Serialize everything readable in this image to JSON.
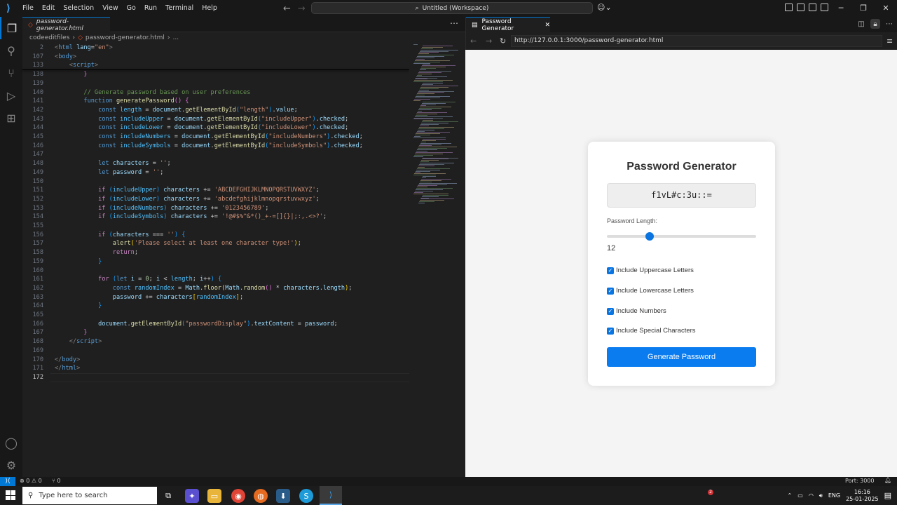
{
  "titlebar": {
    "menu": [
      "File",
      "Edit",
      "Selection",
      "View",
      "Go",
      "Run",
      "Terminal",
      "Help"
    ],
    "command_center": "Untitled (Workspace)"
  },
  "editor": {
    "tab_label": "password-generator.html",
    "breadcrumb": [
      "codeeditfiles",
      "password-generator.html",
      "..."
    ],
    "lines": [
      {
        "n": "2",
        "html": "<span class='p'>&lt;</span><span class='t'>html</span> <span class='v'>lang</span>=<span class='s'>\"en\"</span><span class='p'>&gt;</span>"
      },
      {
        "n": "107",
        "html": "<span class='p'>&lt;</span><span class='t'>body</span><span class='p'>&gt;</span>"
      },
      {
        "n": "133",
        "html": "    <span class='p'>&lt;</span><span class='t'>script</span><span class='p'>&gt;</span>"
      },
      {
        "n": "138",
        "html": "        <span class='br2'>}</span>"
      },
      {
        "n": "139",
        "html": ""
      },
      {
        "n": "140",
        "html": "        <span class='c'>// Generate password based on user preferences</span>"
      },
      {
        "n": "141",
        "html": "        <span class='k'>function</span> <span class='f'>generatePassword</span><span class='br2'>()</span> <span class='br2'>{</span>"
      },
      {
        "n": "142",
        "html": "            <span class='k'>const</span> <span class='o'>length</span> = <span class='v'>document</span>.<span class='f'>getElementById</span><span class='br3'>(</span><span class='s'>\"length\"</span><span class='br3'>)</span>.<span class='v'>value</span>;"
      },
      {
        "n": "143",
        "html": "            <span class='k'>const</span> <span class='o'>includeUpper</span> = <span class='v'>document</span>.<span class='f'>getElementById</span><span class='br3'>(</span><span class='s'>\"includeUpper\"</span><span class='br3'>)</span>.<span class='v'>checked</span>;"
      },
      {
        "n": "144",
        "html": "            <span class='k'>const</span> <span class='o'>includeLower</span> = <span class='v'>document</span>.<span class='f'>getElementById</span><span class='br3'>(</span><span class='s'>\"includeLower\"</span><span class='br3'>)</span>.<span class='v'>checked</span>;"
      },
      {
        "n": "145",
        "html": "            <span class='k'>const</span> <span class='o'>includeNumbers</span> = <span class='v'>document</span>.<span class='f'>getElementById</span><span class='br3'>(</span><span class='s'>\"includeNumbers\"</span><span class='br3'>)</span>.<span class='v'>checked</span>;"
      },
      {
        "n": "146",
        "html": "            <span class='k'>const</span> <span class='o'>includeSymbols</span> = <span class='v'>document</span>.<span class='f'>getElementById</span><span class='br3'>(</span><span class='s'>\"includeSymbols\"</span><span class='br3'>)</span>.<span class='v'>checked</span>;"
      },
      {
        "n": "147",
        "html": ""
      },
      {
        "n": "148",
        "html": "            <span class='k'>let</span> <span class='v'>characters</span> = <span class='s'>''</span>;"
      },
      {
        "n": "149",
        "html": "            <span class='k'>let</span> <span class='v'>password</span> = <span class='s'>''</span>;"
      },
      {
        "n": "150",
        "html": ""
      },
      {
        "n": "151",
        "html": "            <span class='kc'>if</span> <span class='br3'>(</span><span class='o'>includeUpper</span><span class='br3'>)</span> <span class='v'>characters</span> += <span class='s'>'ABCDEFGHIJKLMNOPQRSTUVWXYZ'</span>;"
      },
      {
        "n": "152",
        "html": "            <span class='kc'>if</span> <span class='br3'>(</span><span class='o'>includeLower</span><span class='br3'>)</span> <span class='v'>characters</span> += <span class='s'>'abcdefghijklmnopqrstuvwxyz'</span>;"
      },
      {
        "n": "153",
        "html": "            <span class='kc'>if</span> <span class='br3'>(</span><span class='o'>includeNumbers</span><span class='br3'>)</span> <span class='v'>characters</span> += <span class='s'>'0123456789'</span>;"
      },
      {
        "n": "154",
        "html": "            <span class='kc'>if</span> <span class='br3'>(</span><span class='o'>includeSymbols</span><span class='br3'>)</span> <span class='v'>characters</span> += <span class='s'>'!@#$%^&amp;*()_+-=[]{}|;:,.&lt;&gt;?'</span>;"
      },
      {
        "n": "155",
        "html": ""
      },
      {
        "n": "156",
        "html": "            <span class='kc'>if</span> <span class='br3'>(</span><span class='v'>characters</span> === <span class='s'>''</span><span class='br3'>)</span> <span class='br3'>{</span>"
      },
      {
        "n": "157",
        "html": "                <span class='f'>alert</span><span class='br'>(</span><span class='s'>'Please select at least one character type!'</span><span class='br'>)</span>;"
      },
      {
        "n": "158",
        "html": "                <span class='kc'>return</span>;"
      },
      {
        "n": "159",
        "html": "            <span class='br3'>}</span>"
      },
      {
        "n": "160",
        "html": ""
      },
      {
        "n": "161",
        "html": "            <span class='kc'>for</span> <span class='br3'>(</span><span class='k'>let</span> <span class='v'>i</span> = <span class='n'>0</span>; <span class='v'>i</span> &lt; <span class='o'>length</span>; <span class='v'>i</span>++<span class='br3'>)</span> <span class='br3'>{</span>"
      },
      {
        "n": "162",
        "html": "                <span class='k'>const</span> <span class='o'>randomIndex</span> = <span class='v'>Math</span>.<span class='f'>floor</span><span class='br'>(</span><span class='v'>Math</span>.<span class='f'>random</span><span class='br2'>()</span> * <span class='v'>characters</span>.<span class='v'>length</span><span class='br'>)</span>;"
      },
      {
        "n": "163",
        "html": "                <span class='v'>password</span> += <span class='v'>characters</span><span class='br'>[</span><span class='o'>randomIndex</span><span class='br'>]</span>;"
      },
      {
        "n": "164",
        "html": "            <span class='br3'>}</span>"
      },
      {
        "n": "165",
        "html": ""
      },
      {
        "n": "166",
        "html": "            <span class='v'>document</span>.<span class='f'>getElementById</span><span class='br3'>(</span><span class='s'>\"passwordDisplay\"</span><span class='br3'>)</span>.<span class='v'>textContent</span> = <span class='v'>password</span>;"
      },
      {
        "n": "167",
        "html": "        <span class='br2'>}</span>"
      },
      {
        "n": "168",
        "html": "    <span class='p'>&lt;/</span><span class='t'>script</span><span class='p'>&gt;</span>"
      },
      {
        "n": "169",
        "html": ""
      },
      {
        "n": "170",
        "html": "<span class='p'>&lt;/</span><span class='t'>body</span><span class='p'>&gt;</span>"
      },
      {
        "n": "171",
        "html": "<span class='p'>&lt;/</span><span class='t'>html</span><span class='p'>&gt;</span>"
      },
      {
        "n": "172",
        "html": ""
      }
    ]
  },
  "browser": {
    "tab_label": "Password Generator",
    "url": "http://127.0.0.1:3000/password-generator.html",
    "app": {
      "title": "Password Generator",
      "password": "f1vL#c:3u::=",
      "length_label": "Password Length:",
      "length_value": "12",
      "length_min": 4,
      "length_max": 32,
      "options": [
        {
          "label": "Include Uppercase Letters",
          "checked": true
        },
        {
          "label": "Include Lowercase Letters",
          "checked": true
        },
        {
          "label": "Include Numbers",
          "checked": true
        },
        {
          "label": "Include Special Characters",
          "checked": true
        }
      ],
      "generate_label": "Generate Password"
    }
  },
  "statusbar": {
    "problems": "⊗ 0 ⚠ 0",
    "ports_info": "⑂ 0",
    "port": "Port: 3000"
  },
  "taskbar": {
    "search_placeholder": "Type here to search",
    "lang": "ENG",
    "time": "16:16",
    "date": "25-01-2025",
    "badge": "2"
  },
  "colors": {
    "accent": "#0078d4",
    "button": "#0a7cf0"
  }
}
